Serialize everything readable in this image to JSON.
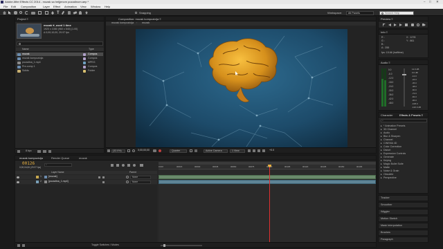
{
  "titlebar": {
    "title": "Adobe After Effects CC 2014 - mozak sa heljjenom pozadinom.aep *",
    "controls": [
      "–",
      "□",
      "✕"
    ]
  },
  "menu": [
    "File",
    "Edit",
    "Composition",
    "Layer",
    "Effect",
    "Animation",
    "View",
    "Window",
    "Help"
  ],
  "toolbar": {
    "snapping": "Snapping",
    "workspace_label": "Workspace:",
    "workspace_value": "All Panels",
    "search_placeholder": "Search Help"
  },
  "project": {
    "tab": "Project ≡",
    "preview_name": "mozak ▾, used 1 time",
    "preview_info": [
      "1920 x 1080 (960 x 540) (1.00)",
      "Δ 0;00;10;00, 29.97 fps"
    ],
    "col_name": "Name",
    "col_type": "Type",
    "items": [
      {
        "name": "mozak",
        "type": "Compos"
      },
      {
        "name": "mozak kompozicija",
        "type": "Compos"
      },
      {
        "name": "pozadina_1.mp4",
        "type": "MPEG"
      },
      {
        "name": "Pre-comp 1",
        "type": "Compos"
      },
      {
        "name": "Solids",
        "type": "Folder"
      }
    ],
    "bpc": "8 bpc"
  },
  "comp_viewer": {
    "tab_prefix": "Composition: mozak kompozicija ≡",
    "breadcrumbs": [
      "mozak kompozicija",
      "mozak"
    ],
    "zoom": "(32.0%)",
    "timecode": "0;00;00;00",
    "quality": "Quarter",
    "camera": "Active Camera",
    "view": "1 View",
    "offset": "+0.0"
  },
  "preview_panel": {
    "tab": "Preview ≡"
  },
  "info_panel": {
    "tab": "Info ≡",
    "channels": [
      "R :",
      "G :",
      "B :",
      "A : 255"
    ],
    "coords": [
      "X : 1278",
      "Y : 861"
    ],
    "bpc_line": "fps: 15.66 (halftime)"
  },
  "audio_panel": {
    "tab": "Audio ≡",
    "db_left": [
      "0.0",
      "-6.0",
      "-12.0",
      "-18.0",
      "-24.0",
      "-30.0",
      "-36.0",
      "-42.0",
      "-48.0"
    ],
    "db_right": [
      "12.0 dB",
      "0.0 dB",
      "-12.0",
      "-24.0",
      "-36.0",
      "-48.0",
      "-60.0",
      "-72.0",
      "-84.0",
      "-96.0",
      "-108.0",
      "-120.0 dB"
    ]
  },
  "effects_panel": {
    "tabs": [
      "Character",
      "Effects & Presets ≡"
    ],
    "search_placeholder": "⌕",
    "categories": [
      "* Animation Presets",
      "3D Channel",
      "Audio",
      "Blur & Sharpen",
      "Channel",
      "CINEMA 4D",
      "Color Correction",
      "Distort",
      "Expression Controls",
      "Generate",
      "Keying",
      "Magic Bullet Suite",
      "Matte",
      "Noise & Grain",
      "Obsolete",
      "Perspective"
    ]
  },
  "side_panels": [
    "Tracker",
    "Smoother",
    "Wiggler",
    "Motion Sketch",
    "Mask Interpolation",
    "Brushes",
    "Paragraph"
  ],
  "timeline": {
    "tabs": [
      "mozak kompozicija",
      "Render Queue",
      "mozak"
    ],
    "timecode": "00126",
    "timecode_sub": "0;00;04;06 (29.97 fps)",
    "search_placeholder": "⌕",
    "col_layer": "Layer Name",
    "col_parent": "Parent",
    "layers": [
      {
        "num": "1",
        "name": "[mozak]",
        "parent": "None",
        "color": "#c8a94f"
      },
      {
        "num": "2",
        "name": "[pozadina_1.mp4]",
        "parent": "None",
        "color": "#7aa0b8"
      }
    ],
    "ruler": [
      "0:00f",
      "00015",
      "00030",
      "00045",
      "00060",
      "00075",
      "00090",
      "00105",
      "00120",
      "00135",
      "00150",
      "00165"
    ],
    "playhead_frac": 0.51,
    "footer": "Toggle Switches / Modes"
  }
}
